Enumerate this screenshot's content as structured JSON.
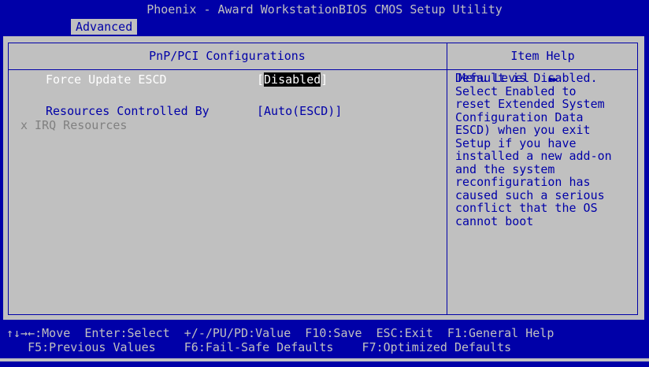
{
  "window": {
    "title": "Phoenix - Award WorkstationBIOS CMOS Setup Utility"
  },
  "menu": {
    "active_tab": "Advanced"
  },
  "panel": {
    "title": "PnP/PCI Configurations",
    "items": [
      {
        "label": "Force Update ESCD",
        "value_left": "[",
        "value_selected": "Disabled",
        "value_right": "]"
      },
      {
        "label": "Resources Controlled By",
        "value": "[Auto(ESCD)]"
      },
      {
        "label": "x IRQ Resources"
      }
    ]
  },
  "help": {
    "title": "Item Help",
    "menu_level_label": "Menu Level",
    "menu_level_marker": "▶▶",
    "text": "Default is Disabled.\nSelect Enabled to\nreset Extended System\nConfiguration Data\nESCD) when you exit\nSetup if you have\ninstalled a new add-on\nand the system\nreconfiguration has\ncaused such a serious\nconflict that the OS\ncannot boot"
  },
  "footer": {
    "line1": "↑↓→←:Move  Enter:Select  +/-/PU/PD:Value  F10:Save  ESC:Exit  F1:General Help",
    "line2": "   F5:Previous Values    F6:Fail-Safe Defaults    F7:Optimized Defaults"
  }
}
